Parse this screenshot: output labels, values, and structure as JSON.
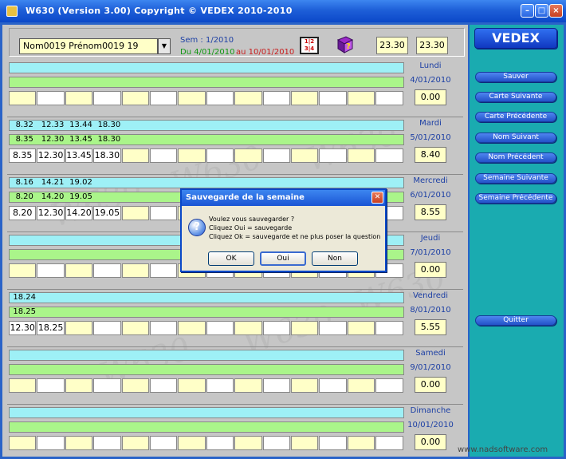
{
  "window": {
    "title": "W630  (Version 3.00)     Copyright  ©    VEDEX  2010-2010"
  },
  "header": {
    "employee": "Nom0019 Prénom0019 19",
    "week_label": "Sem : 1/2010",
    "du": "Du  4/01/2010",
    "au": "au  10/01/2010",
    "calc_icon_text": "1|2\n3|4",
    "total_left": "23.30",
    "total_right": "23.30",
    "icons": {
      "calc": "calculator-icon",
      "book": "help-book-icon"
    }
  },
  "days": [
    {
      "name": "Lundi",
      "date": "4/01/2010",
      "total": "0.00",
      "cyan": [],
      "green": [],
      "cells": [
        "",
        "",
        "",
        "",
        "",
        "",
        "",
        "",
        "",
        "",
        "",
        "",
        "",
        ""
      ]
    },
    {
      "name": "Mardi",
      "date": "5/01/2010",
      "total": "8.40",
      "cyan": [
        "8.32",
        "12.33",
        "13.44",
        "18.30"
      ],
      "green": [
        "8.35",
        "12.30",
        "13.45",
        "18.30"
      ],
      "cells": [
        "8.35",
        "12.30",
        "13.45",
        "18.30",
        "",
        "",
        "",
        "",
        "",
        "",
        "",
        "",
        "",
        ""
      ]
    },
    {
      "name": "Mercredi",
      "date": "6/01/2010",
      "total": "8.55",
      "cyan": [
        "8.16",
        "14.21",
        "19.02"
      ],
      "green": [
        "8.20",
        "14.20",
        "19.05"
      ],
      "cells": [
        "8.20",
        "12.30",
        "14.20",
        "19.05",
        "",
        "",
        "",
        "",
        "",
        "",
        "",
        "",
        "",
        ""
      ]
    },
    {
      "name": "Jeudi",
      "date": "7/01/2010",
      "total": "0.00",
      "cyan": [],
      "green": [],
      "cells": [
        "",
        "",
        "",
        "",
        "",
        "",
        "",
        "",
        "",
        "",
        "",
        "",
        "",
        ""
      ]
    },
    {
      "name": "Vendredi",
      "date": "8/01/2010",
      "total": "5.55",
      "cyan": [
        "18.24"
      ],
      "green": [
        "18.25"
      ],
      "cells": [
        "12.30",
        "18.25",
        "",
        "",
        "",
        "",
        "",
        "",
        "",
        "",
        "",
        "",
        "",
        ""
      ]
    },
    {
      "name": "Samedi",
      "date": "9/01/2010",
      "total": "0.00",
      "cyan": [],
      "green": [],
      "cells": [
        "",
        "",
        "",
        "",
        "",
        "",
        "",
        "",
        "",
        "",
        "",
        "",
        "",
        ""
      ]
    },
    {
      "name": "Dimanche",
      "date": "10/01/2010",
      "total": "0.00",
      "cyan": [],
      "green": [],
      "cells": [
        "",
        "",
        "",
        "",
        "",
        "",
        "",
        "",
        "",
        "",
        "",
        "",
        "",
        ""
      ]
    }
  ],
  "sidebar": {
    "brand": "VEDEX",
    "buttons": [
      "Sauver",
      "Carte Suivante",
      "Carte Précédente",
      "Nom Suivant",
      "Nom Précédent",
      "Semaine Suivante",
      "Semaine Précédente"
    ],
    "quit": "Quitter"
  },
  "dialog": {
    "title": "Sauvegarde de la semaine",
    "lines": [
      "Voulez vous sauvegarder ?",
      "Cliquez Oui = sauvegarde",
      "Cliquez Ok = sauvegarde et ne plus poser la question"
    ],
    "buttons": {
      "ok": "OK",
      "oui": "Oui",
      "non": "Non"
    },
    "icon": "question-icon"
  },
  "watermark": "W630",
  "footer": {
    "link": "www.nadsoftware.com"
  }
}
